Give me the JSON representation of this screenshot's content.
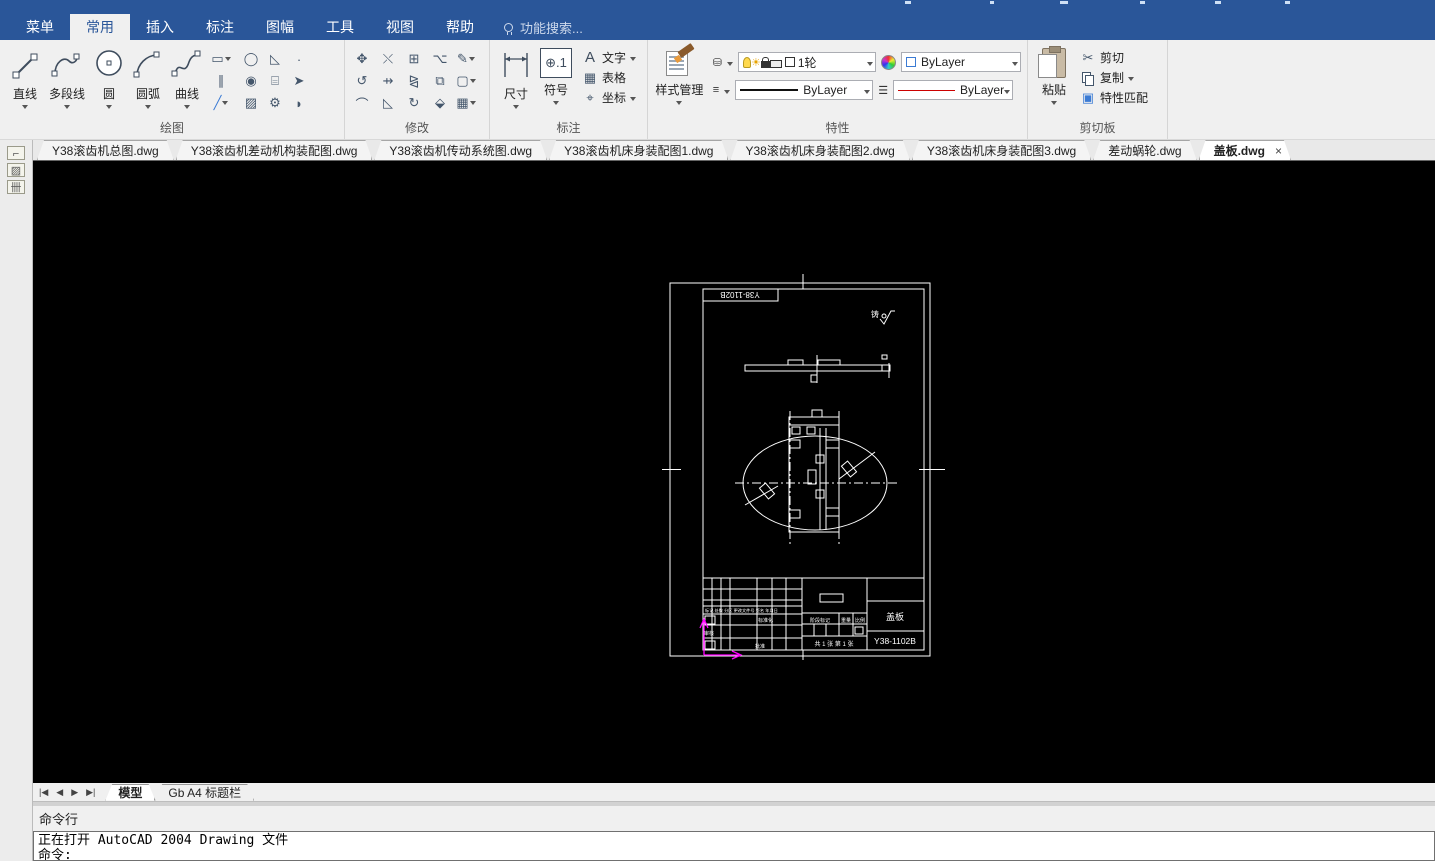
{
  "menu": {
    "items": [
      "菜单",
      "常用",
      "插入",
      "标注",
      "图幅",
      "工具",
      "视图",
      "帮助"
    ],
    "search_label": "功能搜索..."
  },
  "ribbon": {
    "panels": {
      "draw": "绘图",
      "modify": "修改",
      "annotate": "标注",
      "properties": "特性",
      "clipboard": "剪切板"
    },
    "draw_tools": [
      "直线",
      "多段线",
      "圆",
      "圆弧",
      "曲线"
    ],
    "draw_grid": [
      "▭",
      "◯",
      "◺",
      "·",
      "∥",
      "◉",
      "⌸",
      "➤",
      "╱",
      "▨",
      "⚙",
      "◗"
    ],
    "modify_grid": [
      "✥",
      "⤬",
      "⊞",
      "⌥",
      "✎",
      "↺",
      "⇸",
      "⧎",
      "⧉",
      "▢",
      "⌒",
      "◺",
      "↻",
      "⬙",
      "▦"
    ],
    "annotate": {
      "dimension": "尺寸",
      "symbol": "符号",
      "symbol_glyph": "⊕.1",
      "text": "文字",
      "text_glyph": "A",
      "table": "表格",
      "table_glyph": "▦",
      "coord": "坐标",
      "coord_glyph": "⌖"
    },
    "style_manager": "样式管理",
    "layer_combo": "1轮",
    "color_combo": "ByLayer",
    "lineweight_combo": "ByLayer",
    "linetype_combo": "ByLayer",
    "clipboard": {
      "paste": "粘贴",
      "cut": "剪切",
      "cut_glyph": "✂",
      "copy": "复制",
      "match": "特性匹配"
    }
  },
  "doc_tabs": [
    {
      "label": "Y38滚齿机总图.dwg"
    },
    {
      "label": "Y38滚齿机差动机构装配图.dwg"
    },
    {
      "label": "Y38滚齿机传动系统图.dwg"
    },
    {
      "label": "Y38滚齿机床身装配图1.dwg"
    },
    {
      "label": "Y38滚齿机床身装配图2.dwg"
    },
    {
      "label": "Y38滚齿机床身装配图3.dwg"
    },
    {
      "label": "差动蜗轮.dwg"
    },
    {
      "label": "盖板.dwg",
      "close": "×"
    }
  ],
  "drawing": {
    "drawing_no_top": "Y38-1102B",
    "roughness_note": "铸",
    "title_block": {
      "header_row": "标记 处数 分区 更改文件号 签名 年月日",
      "row_standard": "标准化",
      "row_check": "审核",
      "row_approve": "批准",
      "stage": "阶段标记",
      "weight": "重量",
      "scale": "比例",
      "sheet": "共 1 张 第 1 张",
      "part_name": "盖板",
      "part_no": "Y38-1102B"
    }
  },
  "layout_tabs": {
    "items": [
      "模型",
      "Gb A4 标题栏"
    ]
  },
  "command": {
    "label": "命令行",
    "lines": [
      "正在打开 AutoCAD 2004 Drawing 文件",
      "命令:"
    ]
  }
}
